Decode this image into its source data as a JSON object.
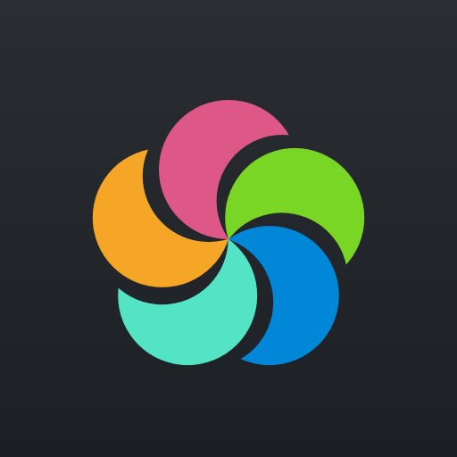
{
  "icon": {
    "name": "app-logo-icon",
    "background": "#25282d",
    "petals": [
      {
        "name": "pink-petal",
        "color": "#dd5886"
      },
      {
        "name": "green-petal",
        "color": "#7ad624"
      },
      {
        "name": "blue-petal",
        "color": "#0087d8"
      },
      {
        "name": "teal-petal",
        "color": "#52e4c4"
      },
      {
        "name": "orange-petal",
        "color": "#f6a626"
      }
    ]
  }
}
